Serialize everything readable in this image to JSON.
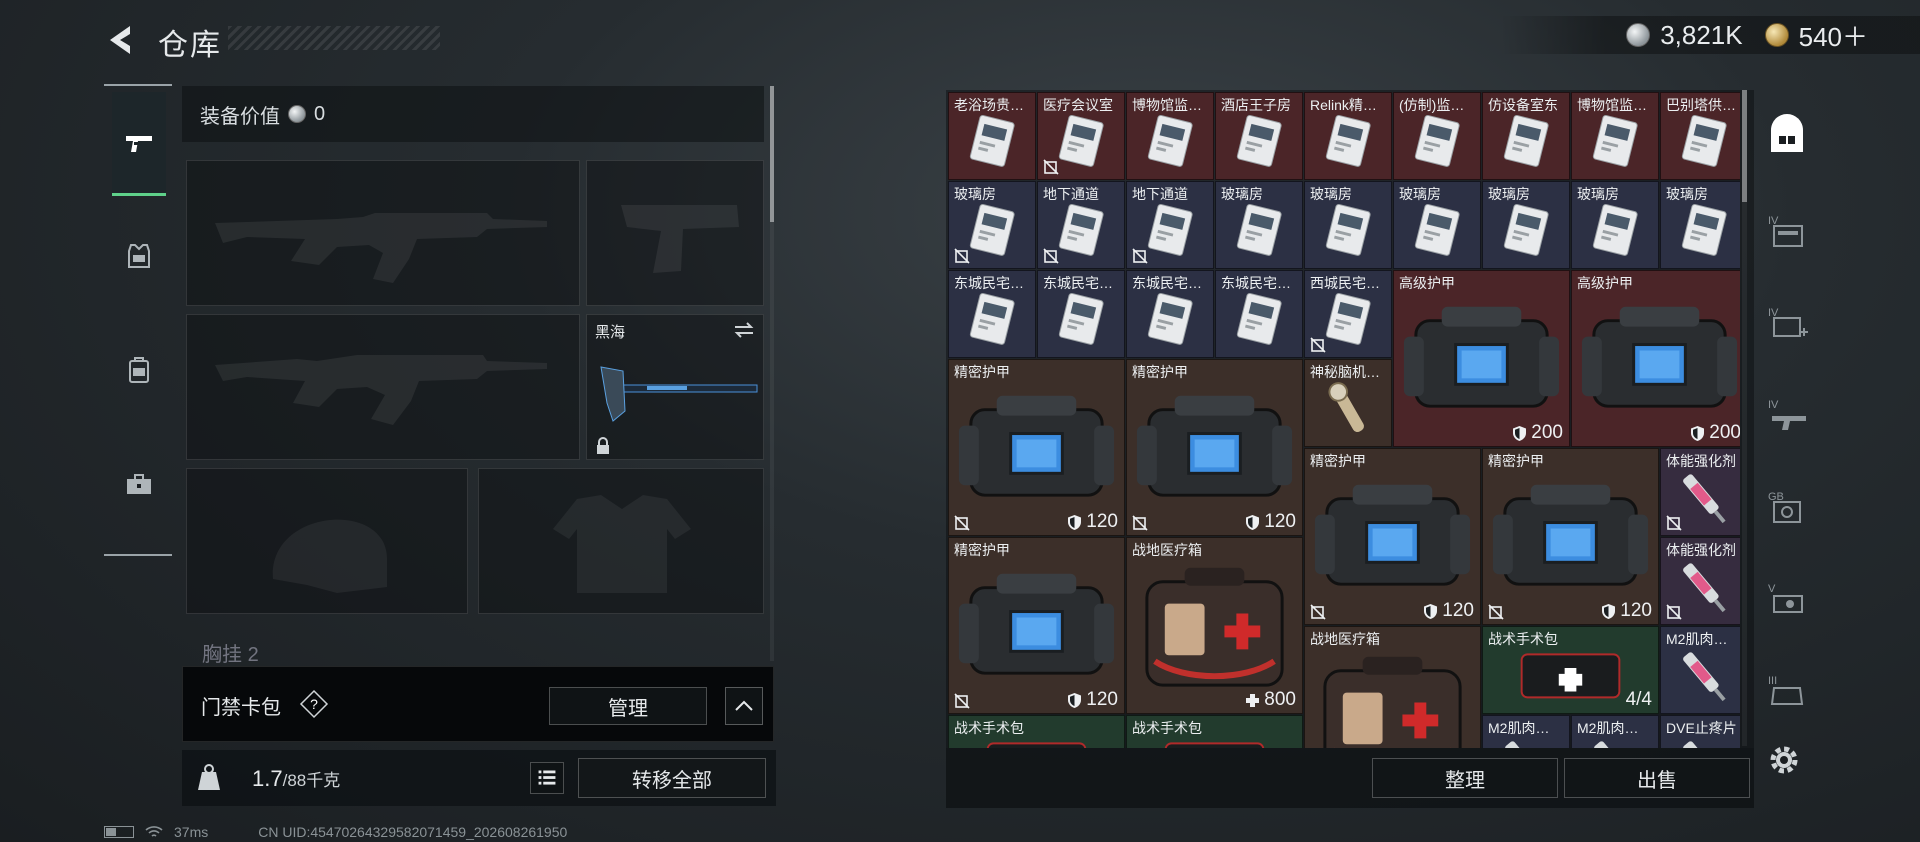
{
  "header": {
    "title": "仓库",
    "currency_silver": "3,821K",
    "currency_gold": "540＋"
  },
  "colors": {
    "accent_green": "#5fd18a",
    "rarity_red": "#4b2528",
    "rarity_blue": "#2c3044",
    "rarity_brown": "#3c2f29",
    "rarity_purple": "#362c3f",
    "rarity_green": "#223b2d"
  },
  "left_tabs": [
    {
      "icon": "pistol-icon",
      "active": true
    },
    {
      "icon": "armor-vest-icon",
      "active": false
    },
    {
      "icon": "backpack-icon",
      "active": false
    },
    {
      "icon": "toolbox-icon",
      "active": false
    }
  ],
  "equipment": {
    "value_label": "装备价值",
    "value": "0",
    "melee_name": "黑海",
    "chest_label": "胸挂",
    "chest_count": "2"
  },
  "keycard": {
    "label": "门禁卡包",
    "help": "?",
    "manage": "管理"
  },
  "capacity": {
    "current": "1.7",
    "max": "/88千克",
    "transfer_all": "转移全部"
  },
  "stash_items": [
    {
      "name": "老浴场贵…",
      "rarity": "red",
      "art": "keycard",
      "nodiscard": false
    },
    {
      "name": "医疗会议室",
      "rarity": "red",
      "art": "keycard",
      "nodiscard": true
    },
    {
      "name": "博物馆监…",
      "rarity": "red",
      "art": "keycard",
      "nodiscard": false
    },
    {
      "name": "酒店王子房",
      "rarity": "red",
      "art": "keycard",
      "nodiscard": false
    },
    {
      "name": "Relink精…",
      "rarity": "red",
      "art": "keycard",
      "nodiscard": false
    },
    {
      "name": "(仿制)监…",
      "rarity": "red",
      "art": "keycard",
      "nodiscard": false
    },
    {
      "name": "仿设备室东",
      "rarity": "red",
      "art": "keycard",
      "nodiscard": false
    },
    {
      "name": "博物馆监…",
      "rarity": "red",
      "art": "keycard",
      "nodiscard": false
    },
    {
      "name": "巴别塔供…",
      "rarity": "red",
      "art": "keycard",
      "nodiscard": false
    },
    {
      "name": "玻璃房",
      "rarity": "blue",
      "art": "keycard",
      "nodiscard": true
    },
    {
      "name": "地下通道",
      "rarity": "blue",
      "art": "keycard",
      "nodiscard": true
    },
    {
      "name": "地下通道",
      "rarity": "blue",
      "art": "keycard",
      "nodiscard": true
    },
    {
      "name": "玻璃房",
      "rarity": "blue",
      "art": "keycard",
      "nodiscard": false
    },
    {
      "name": "玻璃房",
      "rarity": "blue",
      "art": "keycard",
      "nodiscard": false
    },
    {
      "name": "玻璃房",
      "rarity": "blue",
      "art": "keycard",
      "nodiscard": false
    },
    {
      "name": "玻璃房",
      "rarity": "blue",
      "art": "keycard",
      "nodiscard": false
    },
    {
      "name": "玻璃房",
      "rarity": "blue",
      "art": "keycard",
      "nodiscard": false
    },
    {
      "name": "玻璃房",
      "rarity": "blue",
      "art": "keycard",
      "nodiscard": false
    },
    {
      "name": "东城民宅…",
      "rarity": "blue",
      "art": "keycard",
      "nodiscard": false
    },
    {
      "name": "东城民宅…",
      "rarity": "blue",
      "art": "keycard",
      "nodiscard": false
    },
    {
      "name": "东城民宅…",
      "rarity": "blue",
      "art": "keycard",
      "nodiscard": false
    },
    {
      "name": "东城民宅…",
      "rarity": "blue",
      "art": "keycard",
      "nodiscard": false
    },
    {
      "name": "西城民宅…",
      "rarity": "blue",
      "art": "keycard",
      "nodiscard": true
    },
    {
      "name": "高级护甲",
      "rarity": "red",
      "art": "armor",
      "nodiscard": false,
      "durability": "200"
    },
    {
      "name": "高级护甲",
      "rarity": "red",
      "art": "armor",
      "nodiscard": false,
      "durability": "200"
    },
    {
      "name": "精密护甲",
      "rarity": "brown",
      "art": "armor",
      "nodiscard": true,
      "durability": "120"
    },
    {
      "name": "精密护甲",
      "rarity": "brown",
      "art": "armor",
      "nodiscard": true,
      "durability": "120"
    },
    {
      "name": "神秘脑机…",
      "rarity": "brown",
      "art": "device",
      "nodiscard": false
    },
    {
      "name": "精密护甲",
      "rarity": "brown",
      "art": "armor",
      "nodiscard": true,
      "durability": "120"
    },
    {
      "name": "精密护甲",
      "rarity": "brown",
      "art": "armor",
      "nodiscard": true,
      "durability": "120"
    },
    {
      "name": "体能强化剂",
      "rarity": "purple",
      "art": "syringe",
      "nodiscard": true
    },
    {
      "name": "精密护甲",
      "rarity": "brown",
      "art": "armor",
      "nodiscard": true,
      "durability": "120"
    },
    {
      "name": "战地医疗箱",
      "rarity": "brown",
      "art": "medkit",
      "nodiscard": false,
      "heal": "800"
    },
    {
      "name": "体能强化剂",
      "rarity": "purple",
      "art": "syringe",
      "nodiscard": true
    },
    {
      "name": "战地医疗箱",
      "rarity": "brown",
      "art": "medkit",
      "nodiscard": false
    },
    {
      "name": "战术手术包",
      "rarity": "green",
      "art": "surgerykit",
      "nodiscard": false,
      "count": "4/4"
    },
    {
      "name": "M2肌肉…",
      "rarity": "blue",
      "art": "syringe",
      "nodiscard": false
    },
    {
      "name": "战术手术包",
      "rarity": "green",
      "art": "surgerykit",
      "nodiscard": false
    },
    {
      "name": "战术手术包",
      "rarity": "green",
      "art": "surgerykit",
      "nodiscard": false
    },
    {
      "name": "M2肌肉…",
      "rarity": "blue",
      "art": "syringe",
      "nodiscard": false
    },
    {
      "name": "M2肌肉…",
      "rarity": "blue",
      "art": "syringe",
      "nodiscard": false
    },
    {
      "name": "DVE止疼片",
      "rarity": "blue",
      "art": "syringe",
      "nodiscard": false
    }
  ],
  "stash_footer": {
    "sort": "整理",
    "sell": "出售"
  },
  "right_rail": [
    {
      "icon": "stash-home-icon",
      "active": true
    },
    {
      "icon": "tier4-container-icon",
      "active": false
    },
    {
      "icon": "tier4-medical-icon",
      "active": false
    },
    {
      "icon": "tier4-weapon-icon",
      "active": false
    },
    {
      "icon": "gear-box-icon",
      "active": false
    },
    {
      "icon": "tier5-key-icon",
      "active": false
    },
    {
      "icon": "tier3-misc-icon",
      "active": false
    }
  ],
  "status_bar": {
    "ping": "37ms",
    "uid": "CN UID:454702643295820714​59_202608261950"
  }
}
